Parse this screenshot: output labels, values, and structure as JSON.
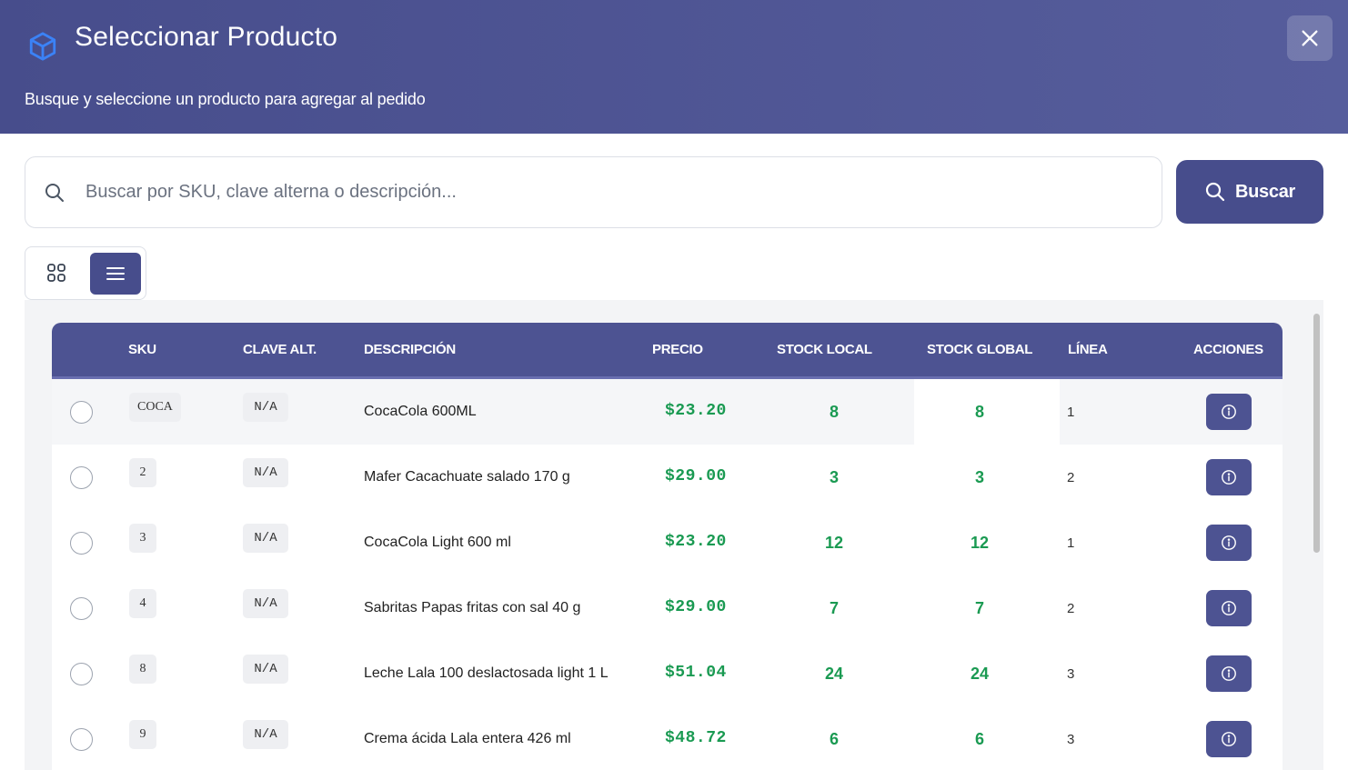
{
  "header": {
    "title": "Seleccionar Producto",
    "subtitle": "Busque y seleccione un producto para agregar al pedido"
  },
  "search": {
    "placeholder": "Buscar por SKU, clave alterna o descripción...",
    "value": "",
    "button_label": "Buscar"
  },
  "view_toggle": {
    "active": "list"
  },
  "table": {
    "columns": [
      "SKU",
      "CLAVE ALT.",
      "DESCRIPCIÓN",
      "PRECIO",
      "STOCK LOCAL",
      "STOCK GLOBAL",
      "LÍNEA",
      "ACCIONES"
    ],
    "rows": [
      {
        "sku": "COCA",
        "alt": "N/A",
        "desc": "CocaCola 600ML",
        "price": "$23.20",
        "stock_local": "8",
        "stock_global": "8",
        "linea": "1"
      },
      {
        "sku": "2",
        "alt": "N/A",
        "desc": "Mafer Cacachuate salado 170 g",
        "price": "$29.00",
        "stock_local": "3",
        "stock_global": "3",
        "linea": "2"
      },
      {
        "sku": "3",
        "alt": "N/A",
        "desc": "CocaCola Light 600 ml",
        "price": "$23.20",
        "stock_local": "12",
        "stock_global": "12",
        "linea": "1"
      },
      {
        "sku": "4",
        "alt": "N/A",
        "desc": "Sabritas Papas fritas con sal 40 g",
        "price": "$29.00",
        "stock_local": "7",
        "stock_global": "7",
        "linea": "2"
      },
      {
        "sku": "8",
        "alt": "N/A",
        "desc": "Leche Lala 100 deslactosada light 1 L",
        "price": "$51.04",
        "stock_local": "24",
        "stock_global": "24",
        "linea": "3"
      },
      {
        "sku": "9",
        "alt": "N/A",
        "desc": "Crema ácida Lala entera 426 ml",
        "price": "$48.72",
        "stock_local": "6",
        "stock_global": "6",
        "linea": "3"
      }
    ]
  },
  "colors": {
    "header_bg": "#4d5392",
    "accent": "#474d8c",
    "stock_green": "#1a9a52"
  },
  "icons": {
    "header": "cube-icon",
    "close": "close-icon",
    "search": "search-icon",
    "grid_view": "grid-icon",
    "list_view": "list-icon",
    "info": "info-icon"
  }
}
